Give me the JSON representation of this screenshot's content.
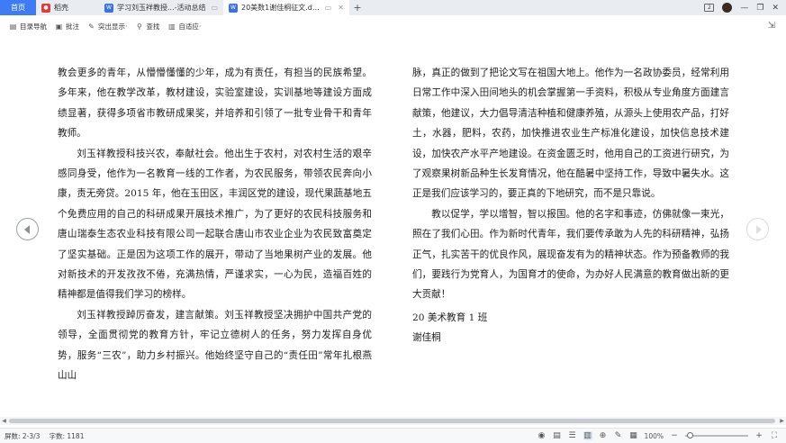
{
  "tabs": [
    {
      "label": "首页"
    },
    {
      "label": "稻壳"
    },
    {
      "label": "学习刘玉祥教授...-活动总结"
    },
    {
      "label": "20美数1谢佳桐征文.docx"
    }
  ],
  "toolbar": {
    "items": [
      {
        "label": "目录导航"
      },
      {
        "label": "批注"
      },
      {
        "label": "突出显示·"
      },
      {
        "label": "查找"
      },
      {
        "label": "自适应·"
      }
    ]
  },
  "document": {
    "left_column": [
      {
        "indent": false,
        "text": "教会更多的青年，从懵懵懂懂的少年，成为有责任，有担当的民族希望。多年来，他在教学改革，教材建设，实验室建设，实训基地等建设方面成绩显著，获得多项省市教研成果奖，并培养和引领了一批专业骨干和青年教师。"
      },
      {
        "indent": true,
        "text": "刘玉祥教授科技兴农，奉献社会。他出生于农村，对农村生活的艰辛感同身受，他作为一名教育一线的工作者，为农民服务，带领农民奔向小康，责无旁贷。2015 年，他在玉田区，丰润区党的建设，现代果蔬基地五个免费应用的自己的科研成果开展技术推广，为了更好的农民科技服务和唐山瑞泰生态农业科技有限公司一起联合唐山市农业企业为农民致富奠定了坚实基础。正是因为这项工作的展开，带动了当地果树产业的发展。他对新技术的开发孜孜不倦，充满热情，严谨求实，一心为民，造福百姓的精神都是值得我们学习的榜样。"
      },
      {
        "indent": true,
        "text": "刘玉祥教授踔厉奋发，建言献策。刘玉祥教授坚决拥护中国共产党的领导，全面贯彻党的教育方针，牢记立德树人的任务，努力发挥自身优势，服务“三农”，助力乡村振兴。他始终坚守自己的“责任田”常年扎根燕山山"
      }
    ],
    "right_column": [
      {
        "indent": false,
        "text": "脉，真正的做到了把论文写在祖国大地上。他作为一名政协委员，经常利用日常工作中深入田间地头的机会掌握第一手资料，积极从专业角度方面建言献策，他建议，大力倡导清洁种植和健康养殖，从源头上使用农产品，打好土，水器，肥料，农药，加快推进农业生产标准化建设，加快信息技术建设，加快农产水平产地建设。在资金匮乏时，他用自己的工资进行研究，为了观察果树新品种生长发育情况，他在酷暑中坚持工作，导致中暑失水。这正是我们应该学习的，要正真的下地研究，而不是只靠说。"
      },
      {
        "indent": true,
        "text": "教以促学，学以增智，智以报国。他的名字和事迹，仿佛就像一束光，照在了我们心田。作为新时代青年，我们要传承敢为人先的科研精神，弘扬正气，扎实苦干的优良作风，展现奋发有为的精神状态。作为预备教师的我们，要践行为党育人，为国育才的使命，为办好人民满意的教育做出新的更大贡献！"
      }
    ],
    "signature_class": "20 美术教育 1 班",
    "signature_name": "谢佳桐"
  },
  "status": {
    "page": "屏数: 2-3/3",
    "words": "字数: 1181",
    "zoom": "100%"
  },
  "colors": {
    "home_tab": "#3d7cf5",
    "tabbar_bg": "#e9edf2"
  }
}
